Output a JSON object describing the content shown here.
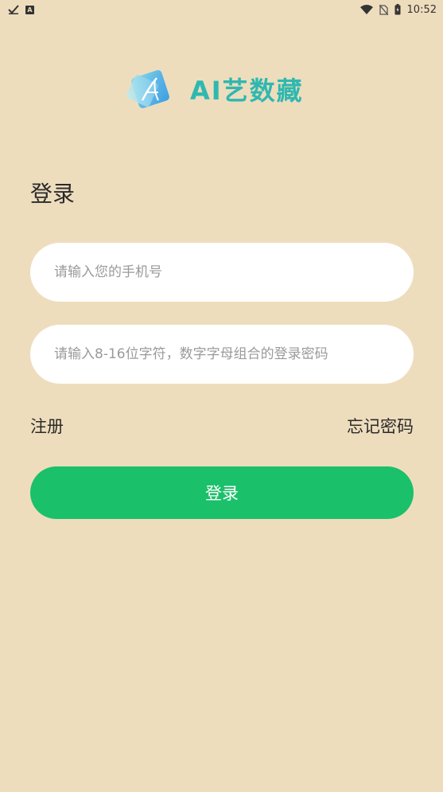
{
  "status_bar": {
    "time": "10:52",
    "left_icons": [
      "check-icon",
      "a-icon"
    ],
    "right_icons": [
      "wifi-icon",
      "no-sim-icon",
      "battery-icon"
    ]
  },
  "logo": {
    "text": "AI艺数藏",
    "text_color": "#2fb8b0"
  },
  "page": {
    "title": "登录",
    "background": "#eeddbd"
  },
  "form": {
    "phone_placeholder": "请输入您的手机号",
    "phone_value": "",
    "password_placeholder": "请输入8-16位字符，数字字母组合的登录密码",
    "password_value": ""
  },
  "links": {
    "register": "注册",
    "forgot_password": "忘记密码"
  },
  "login_button": {
    "label": "登录",
    "color": "#1bc06a"
  }
}
